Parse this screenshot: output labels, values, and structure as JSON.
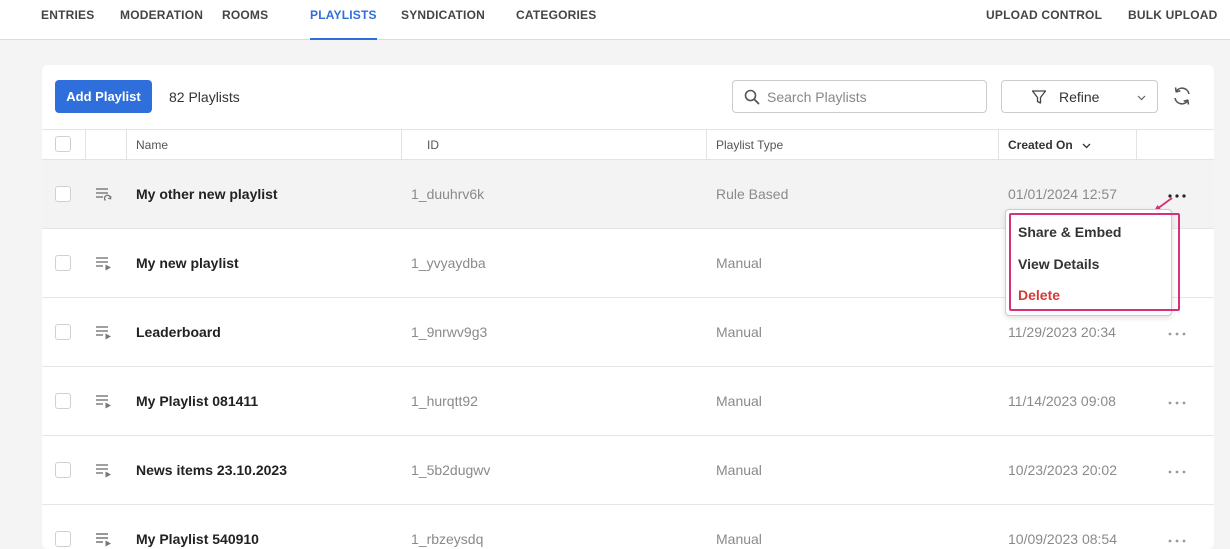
{
  "nav": {
    "left": [
      "ENTRIES",
      "MODERATION",
      "ROOMS",
      "PLAYLISTS",
      "SYNDICATION",
      "CATEGORIES"
    ],
    "active": "PLAYLISTS",
    "right": [
      "UPLOAD CONTROL",
      "BULK UPLOAD"
    ]
  },
  "toolbar": {
    "add_label": "Add Playlist",
    "count_label": "82 Playlists",
    "search_placeholder": "Search Playlists",
    "refine_label": "Refine"
  },
  "table": {
    "columns": [
      "Name",
      "ID",
      "Playlist Type",
      "Created On"
    ],
    "sorted_column": "Created On",
    "rows": [
      {
        "name": "My other new playlist",
        "id": "1_duuhrv6k",
        "type": "Rule Based",
        "created": "01/01/2024 12:57",
        "icon": "rule-playlist-icon"
      },
      {
        "name": "My new playlist",
        "id": "1_yvyaydba",
        "type": "Manual",
        "created": "",
        "icon": "manual-playlist-icon"
      },
      {
        "name": "Leaderboard",
        "id": "1_9nrwv9g3",
        "type": "Manual",
        "created": "11/29/2023 20:34",
        "icon": "manual-playlist-icon"
      },
      {
        "name": "My Playlist 081411",
        "id": "1_hurqtt92",
        "type": "Manual",
        "created": "11/14/2023 09:08",
        "icon": "manual-playlist-icon"
      },
      {
        "name": "News items 23.10.2023",
        "id": "1_5b2dugwv",
        "type": "Manual",
        "created": "10/23/2023 20:02",
        "icon": "manual-playlist-icon"
      },
      {
        "name": "My Playlist 540910",
        "id": "1_rbzeysdq",
        "type": "Manual",
        "created": "10/09/2023 08:54",
        "icon": "manual-playlist-icon"
      }
    ]
  },
  "menu": {
    "items": [
      {
        "label": "Share & Embed",
        "name": "share-embed"
      },
      {
        "label": "View Details",
        "name": "view-details"
      },
      {
        "label": "Delete",
        "name": "delete",
        "danger": true
      }
    ]
  },
  "colors": {
    "accent": "#2f6fdb",
    "highlight": "#d6307a",
    "danger": "#d33a3a"
  }
}
